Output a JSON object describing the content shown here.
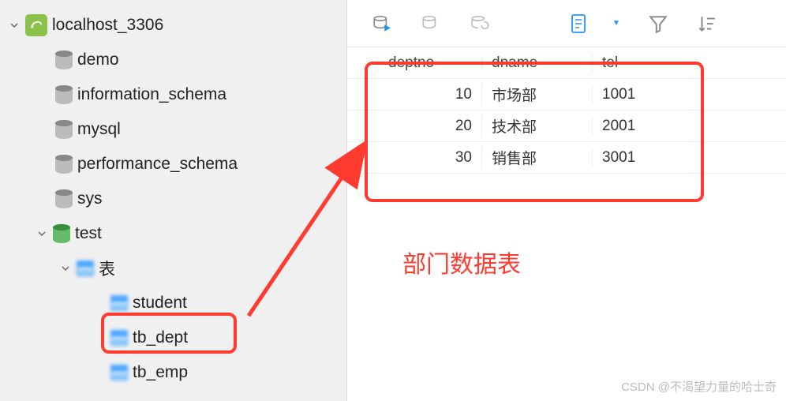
{
  "sidebar": {
    "connection": "localhost_3306",
    "databases": [
      "demo",
      "information_schema",
      "mysql",
      "performance_schema",
      "sys"
    ],
    "active_db": "test",
    "tables_folder": "表",
    "tables": [
      "student",
      "tb_dept",
      "tb_emp"
    ]
  },
  "toolbar": {
    "icons": [
      "run",
      "run2",
      "refresh",
      "doc",
      "filter",
      "sort"
    ]
  },
  "grid": {
    "headers": [
      "deptno",
      "dname",
      "tel"
    ],
    "rows": [
      {
        "deptno": "10",
        "dname": "市场部",
        "tel": "1001"
      },
      {
        "deptno": "20",
        "dname": "技术部",
        "tel": "2001"
      },
      {
        "deptno": "30",
        "dname": "销售部",
        "tel": "3001"
      }
    ]
  },
  "annotation": "部门数据表",
  "watermark": "CSDN @不渴望力量的哈士奇"
}
